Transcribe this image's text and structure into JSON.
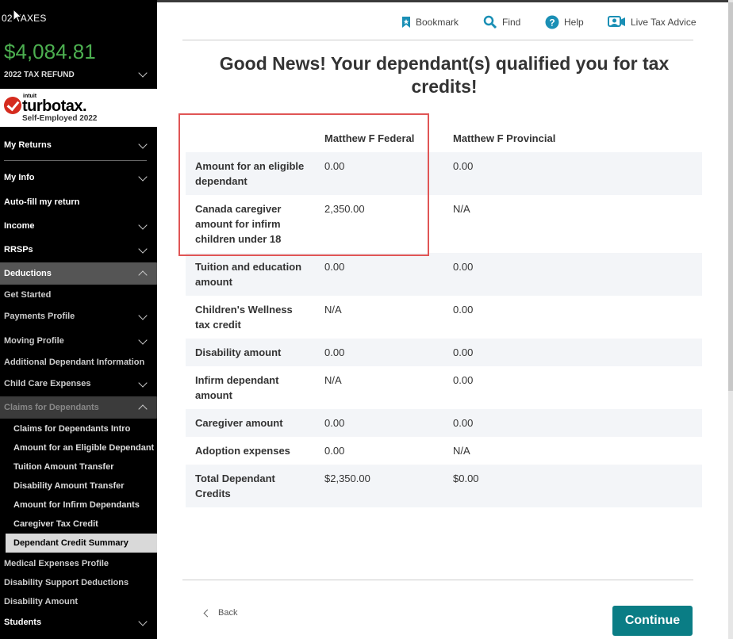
{
  "sidebar": {
    "year_label": "02 TAXES",
    "refund_amount": "$4,084.81",
    "refund_label": "2022 TAX REFUND",
    "logo": {
      "intuit": "intuit",
      "brand": "turbotax.",
      "edition": "Self-Employed 2022"
    },
    "nav": {
      "my_returns": "My Returns",
      "my_info": "My Info",
      "autofill": "Auto-fill my return",
      "income": "Income",
      "rrsps": "RRSPs",
      "deductions": "Deductions",
      "get_started": "Get Started",
      "payments_profile": "Payments Profile",
      "moving_profile": "Moving Profile",
      "additional_dependant": "Additional Dependant Information",
      "child_care": "Child Care Expenses",
      "claims_dependants": "Claims for Dependants",
      "claims_intro": "Claims for Dependants Intro",
      "eligible_dependant": "Amount for an Eligible Dependant",
      "tuition_transfer": "Tuition Amount Transfer",
      "disability_transfer": "Disability Amount Transfer",
      "infirm_dependants": "Amount for Infirm Dependants",
      "caregiver_credit": "Caregiver Tax Credit",
      "dependant_summary": "Dependant Credit Summary",
      "medical_profile": "Medical Expenses Profile",
      "disability_support": "Disability Support Deductions",
      "disability_amount": "Disability Amount",
      "students": "Students"
    }
  },
  "toolbar": {
    "bookmark": "Bookmark",
    "find": "Find",
    "help": "Help",
    "live_advice": "Live Tax Advice"
  },
  "page": {
    "title": "Good News! Your dependant(s) qualified you for tax credits!",
    "columns": {
      "label": "",
      "federal": "Matthew F Federal",
      "provincial": "Matthew F Provincial"
    },
    "rows": [
      {
        "label": "Amount for an eligible dependant",
        "federal": "0.00",
        "provincial": "0.00"
      },
      {
        "label": "Canada caregiver amount for infirm children under 18",
        "federal": "2,350.00",
        "provincial": "N/A"
      },
      {
        "label": "Tuition and education amount",
        "federal": "0.00",
        "provincial": "0.00"
      },
      {
        "label": "Children's Wellness tax credit",
        "federal": "N/A",
        "provincial": "0.00"
      },
      {
        "label": "Disability amount",
        "federal": "0.00",
        "provincial": "0.00"
      },
      {
        "label": "Infirm dependant amount",
        "federal": "N/A",
        "provincial": "0.00"
      },
      {
        "label": "Caregiver amount",
        "federal": "0.00",
        "provincial": "0.00"
      },
      {
        "label": "Adoption expenses",
        "federal": "0.00",
        "provincial": "N/A"
      },
      {
        "label": "Total Dependant Credits",
        "federal": "$2,350.00",
        "provincial": "$0.00"
      }
    ]
  },
  "footer": {
    "back": "Back",
    "continue": "Continue"
  },
  "colors": {
    "refund": "#4caf50",
    "continue": "#0a7d85",
    "highlight": "#e05555",
    "shade": "#f3f5f8"
  }
}
